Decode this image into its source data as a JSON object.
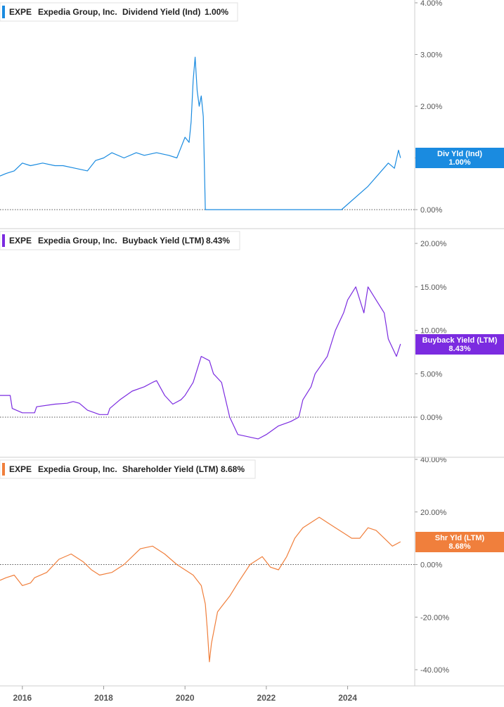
{
  "chart_data": [
    {
      "type": "line",
      "ticker": "EXPE",
      "company": "Expedia Group, Inc.",
      "metric": "Dividend Yield (Ind)",
      "value_label": "1.00%",
      "color": "#1a8be0",
      "badge_label": "Div Yld (Ind)",
      "badge_value": "1.00%",
      "ylim": [
        0,
        4
      ],
      "yticks": [
        0,
        1,
        2,
        3,
        4
      ],
      "ytick_labels": [
        "0.00%",
        "1.00%",
        "2.00%",
        "3.00%",
        "4.00%"
      ],
      "series": [
        {
          "x": [
            2015.45,
            2015.6,
            2015.8,
            2016.0,
            2016.2,
            2016.5,
            2016.8,
            2017.0,
            2017.3,
            2017.6,
            2017.8,
            2018.0,
            2018.2,
            2018.5,
            2018.8,
            2019.0,
            2019.3,
            2019.6,
            2019.8,
            2019.9,
            2020.0,
            2020.1,
            2020.15,
            2020.2,
            2020.25,
            2020.3,
            2020.35,
            2020.4,
            2020.45,
            2020.5,
            2021.0,
            2022.0,
            2023.0,
            2023.85,
            2024.5,
            2025.0,
            2025.15,
            2025.25,
            2025.3
          ],
          "y": [
            0.65,
            0.7,
            0.75,
            0.9,
            0.85,
            0.9,
            0.85,
            0.85,
            0.8,
            0.75,
            0.95,
            1.0,
            1.1,
            1.0,
            1.1,
            1.05,
            1.1,
            1.05,
            1.0,
            1.2,
            1.4,
            1.3,
            1.7,
            2.5,
            2.95,
            2.3,
            2.0,
            2.2,
            1.8,
            0.0,
            0.0,
            0.0,
            0.0,
            0.0,
            0.45,
            0.9,
            0.8,
            1.15,
            1.0
          ]
        }
      ],
      "zero_line": true
    },
    {
      "type": "line",
      "ticker": "EXPE",
      "company": "Expedia Group, Inc.",
      "metric": "Buyback Yield (LTM)",
      "value_label": "8.43%",
      "color": "#7b2be0",
      "badge_label": "Buyback Yield (LTM)",
      "badge_value": "8.43%",
      "ylim": [
        -5,
        20
      ],
      "yticks": [
        0,
        5,
        10,
        15,
        20
      ],
      "ytick_labels": [
        "0.00%",
        "5.00%",
        "10.00%",
        "15.00%",
        "20.00%"
      ],
      "series": [
        {
          "x": [
            2015.45,
            2015.7,
            2015.75,
            2016.0,
            2016.3,
            2016.35,
            2016.8,
            2017.1,
            2017.25,
            2017.4,
            2017.6,
            2017.9,
            2018.1,
            2018.15,
            2018.4,
            2018.7,
            2019.0,
            2019.2,
            2019.3,
            2019.5,
            2019.7,
            2019.9,
            2020.0,
            2020.2,
            2020.4,
            2020.6,
            2020.7,
            2020.9,
            2021.1,
            2021.3,
            2021.5,
            2021.8,
            2022.0,
            2022.3,
            2022.6,
            2022.8,
            2022.9,
            2023.1,
            2023.2,
            2023.5,
            2023.7,
            2023.9,
            2024.0,
            2024.2,
            2024.4,
            2024.5,
            2024.7,
            2024.9,
            2025.0,
            2025.2,
            2025.3
          ],
          "y": [
            2.5,
            2.5,
            1.0,
            0.5,
            0.5,
            1.2,
            1.5,
            1.6,
            1.8,
            1.6,
            0.8,
            0.3,
            0.3,
            1.0,
            2.0,
            3.0,
            3.5,
            4.0,
            4.2,
            2.5,
            1.5,
            2.0,
            2.5,
            4.0,
            7.0,
            6.5,
            5.0,
            4.0,
            0.0,
            -2.0,
            -2.2,
            -2.5,
            -2.0,
            -1.0,
            -0.5,
            0.0,
            2.0,
            3.5,
            5.0,
            7.0,
            10.0,
            12.0,
            13.5,
            15.0,
            12.0,
            15.0,
            13.5,
            12.0,
            9.0,
            7.0,
            8.43
          ]
        }
      ],
      "zero_line": true
    },
    {
      "type": "line",
      "ticker": "EXPE",
      "company": "Expedia Group, Inc.",
      "metric": "Shareholder Yield (LTM)",
      "value_label": "8.68%",
      "color": "#f07f3c",
      "badge_label": "Shr Yld (LTM)",
      "badge_value": "8.68%",
      "ylim": [
        -45,
        45
      ],
      "yticks": [
        -40,
        -20,
        0,
        20,
        40
      ],
      "ytick_labels": [
        "-40.00%",
        "-20.00%",
        "0.00%",
        "20.00%",
        "40.00%"
      ],
      "series": [
        {
          "x": [
            2015.45,
            2015.6,
            2015.8,
            2016.0,
            2016.2,
            2016.3,
            2016.6,
            2016.9,
            2017.2,
            2017.5,
            2017.7,
            2017.9,
            2018.2,
            2018.5,
            2018.9,
            2019.2,
            2019.5,
            2019.8,
            2020.0,
            2020.2,
            2020.4,
            2020.5,
            2020.55,
            2020.6,
            2020.65,
            2020.8,
            2020.9,
            2021.1,
            2021.3,
            2021.6,
            2021.9,
            2022.1,
            2022.3,
            2022.5,
            2022.7,
            2022.9,
            2023.1,
            2023.3,
            2023.5,
            2023.7,
            2023.9,
            2024.1,
            2024.3,
            2024.5,
            2024.7,
            2024.9,
            2025.1,
            2025.3
          ],
          "y": [
            -6,
            -5,
            -4,
            -8,
            -7,
            -5,
            -3,
            2,
            4,
            1,
            -2,
            -4,
            -3,
            0,
            6,
            7,
            4,
            0,
            -2,
            -4,
            -8,
            -15,
            -25,
            -37,
            -30,
            -18,
            -16,
            -12,
            -7,
            0,
            3,
            -1,
            -2,
            3,
            10,
            14,
            16,
            18,
            16,
            14,
            12,
            10,
            10,
            14,
            13,
            10,
            7,
            8.68
          ]
        }
      ],
      "zero_line": true
    }
  ],
  "x_axis": {
    "range": [
      2015.45,
      2025.65
    ],
    "ticks": [
      2016,
      2018,
      2020,
      2022,
      2024
    ],
    "tick_labels": [
      "2016",
      "2018",
      "2020",
      "2022",
      "2024"
    ]
  }
}
